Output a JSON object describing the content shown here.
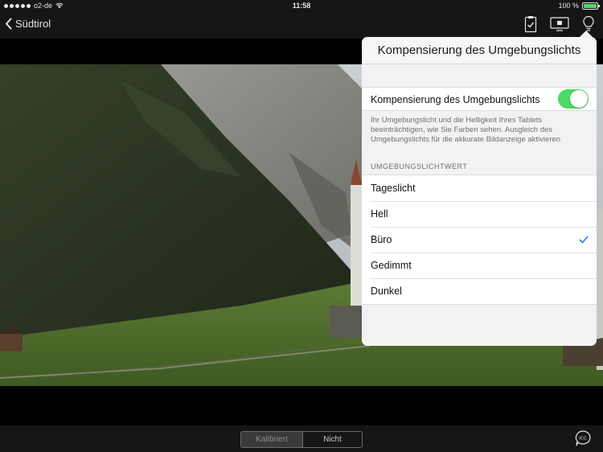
{
  "status_bar": {
    "carrier": "o2-de",
    "time": "11:58",
    "battery_percent": "100 %",
    "battery_level": 1.0
  },
  "nav": {
    "back_label": "Südtirol",
    "icons": [
      "clipboard-check-icon",
      "display-icon",
      "lightbulb-icon"
    ]
  },
  "popover": {
    "title": "Kompensierung des Umgebungslichts",
    "toggle_label": "Kompensierung des Umgebungslichts",
    "toggle_on": true,
    "description": "Ihr Umgebungslicht und die Helligkeit Ihres Tablets beeinträchtigen, wie Sie Farben sehen. Ausgleich des Umgebungslichts für die akkurate Bildanzeige aktivieren",
    "section_header": "UMGEBUNGSLICHTWERT",
    "options": [
      {
        "label": "Tageslicht",
        "selected": false
      },
      {
        "label": "Hell",
        "selected": false
      },
      {
        "label": "Büro",
        "selected": true
      },
      {
        "label": "Gedimmt",
        "selected": false
      },
      {
        "label": "Dunkel",
        "selected": false
      }
    ]
  },
  "bottom_bar": {
    "segment_calibrated": "Kalibriert",
    "segment_uncalibrated": "Nicht kalibriert",
    "active_segment": "Kalibriert",
    "chat_icon_text": "ICC"
  },
  "colors": {
    "accent_green": "#4cd964",
    "checkmark_blue": "#1a7cf5",
    "bar_background": "#161616"
  }
}
